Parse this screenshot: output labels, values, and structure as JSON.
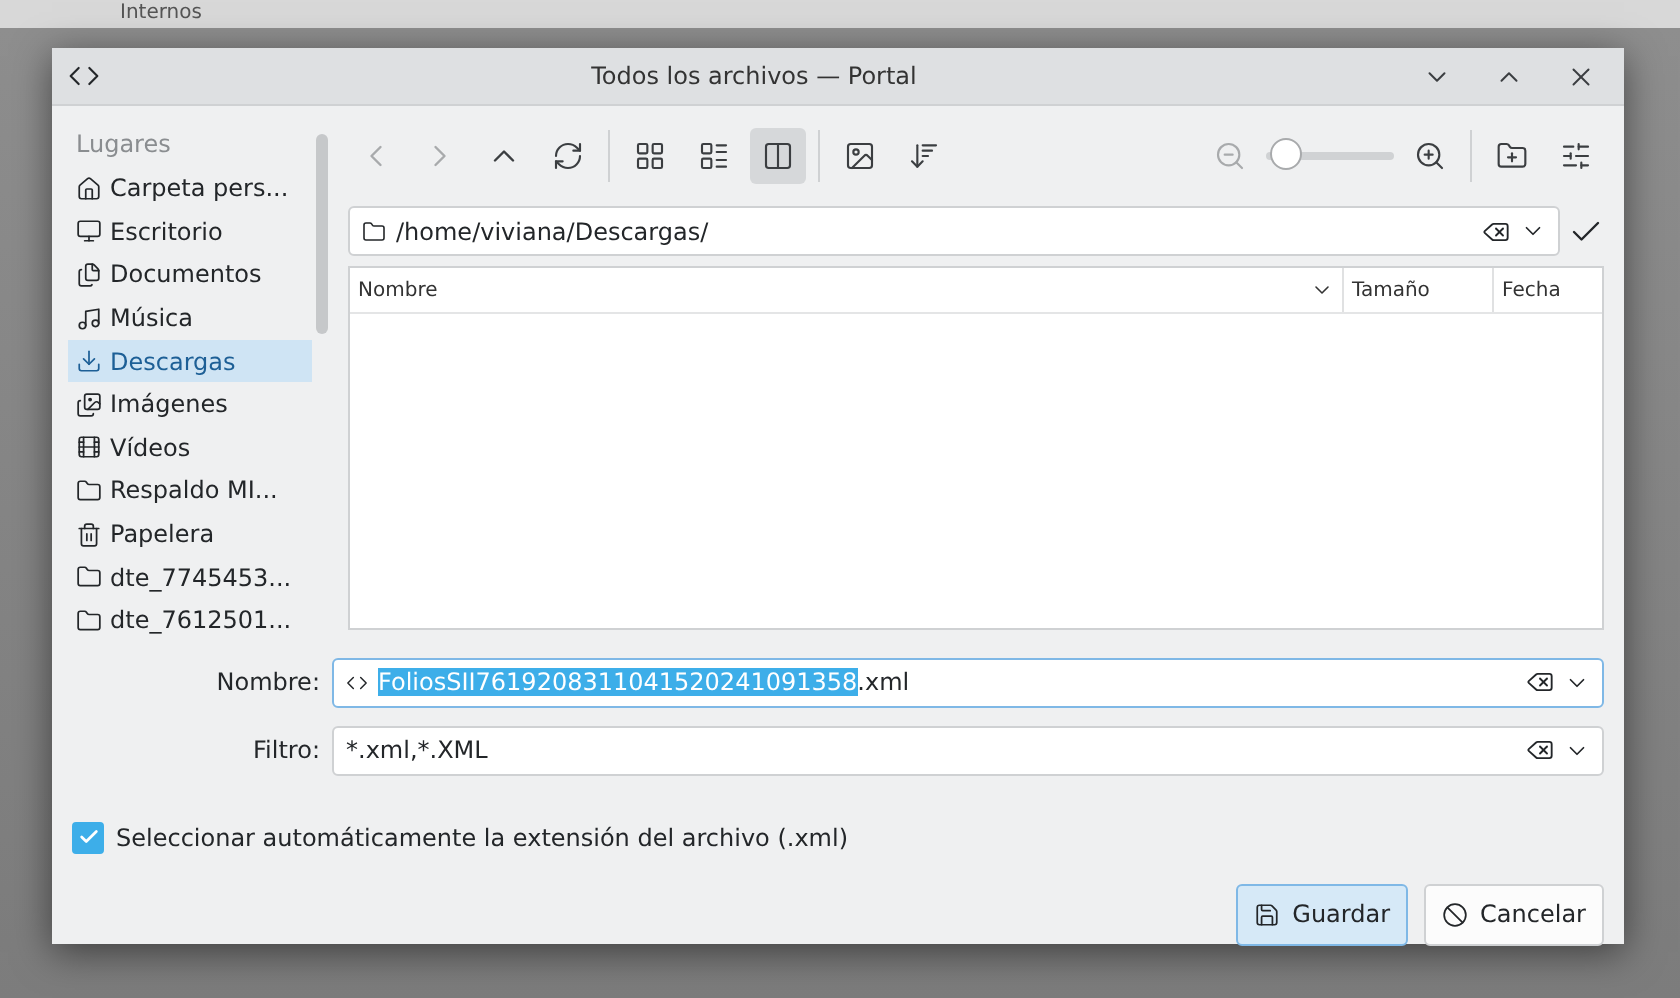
{
  "backdrop": {
    "text": "Internos"
  },
  "window": {
    "title": "Todos los archivos — Portal"
  },
  "sidebar": {
    "heading": "Lugares",
    "items": [
      {
        "label": "Carpeta pers...",
        "selected": false
      },
      {
        "label": "Escritorio",
        "selected": false
      },
      {
        "label": "Documentos",
        "selected": false
      },
      {
        "label": "Música",
        "selected": false
      },
      {
        "label": "Descargas",
        "selected": true
      },
      {
        "label": "Imágenes",
        "selected": false
      },
      {
        "label": "Vídeos",
        "selected": false
      },
      {
        "label": "Respaldo MI...",
        "selected": false
      },
      {
        "label": "Papelera",
        "selected": false
      },
      {
        "label": "dte_7745453...",
        "selected": false
      },
      {
        "label": "dte_7612501...",
        "selected": false
      }
    ]
  },
  "toolbar": {
    "views": [
      {
        "selected": false
      },
      {
        "selected": false
      },
      {
        "selected": true
      }
    ],
    "zoom": {
      "level": 0.04
    }
  },
  "path": {
    "value": "/home/viviana/Descargas/"
  },
  "table": {
    "columns": [
      {
        "label": "Nombre"
      },
      {
        "label": "Tamaño"
      },
      {
        "label": "Fecha"
      }
    ]
  },
  "name_field": {
    "label": "Nombre:",
    "selected_text": "FoliosSII7619208311041520241091358",
    "rest_text": ".xml"
  },
  "filter_field": {
    "label": "Filtro:",
    "value": "*.xml,*.XML"
  },
  "auto_extension": {
    "label": "Seleccionar automáticamente la extensión del archivo (.xml)",
    "checked": true
  },
  "buttons": [
    {
      "label": "Guardar",
      "default": true
    },
    {
      "label": "Cancelar",
      "default": false
    }
  ]
}
